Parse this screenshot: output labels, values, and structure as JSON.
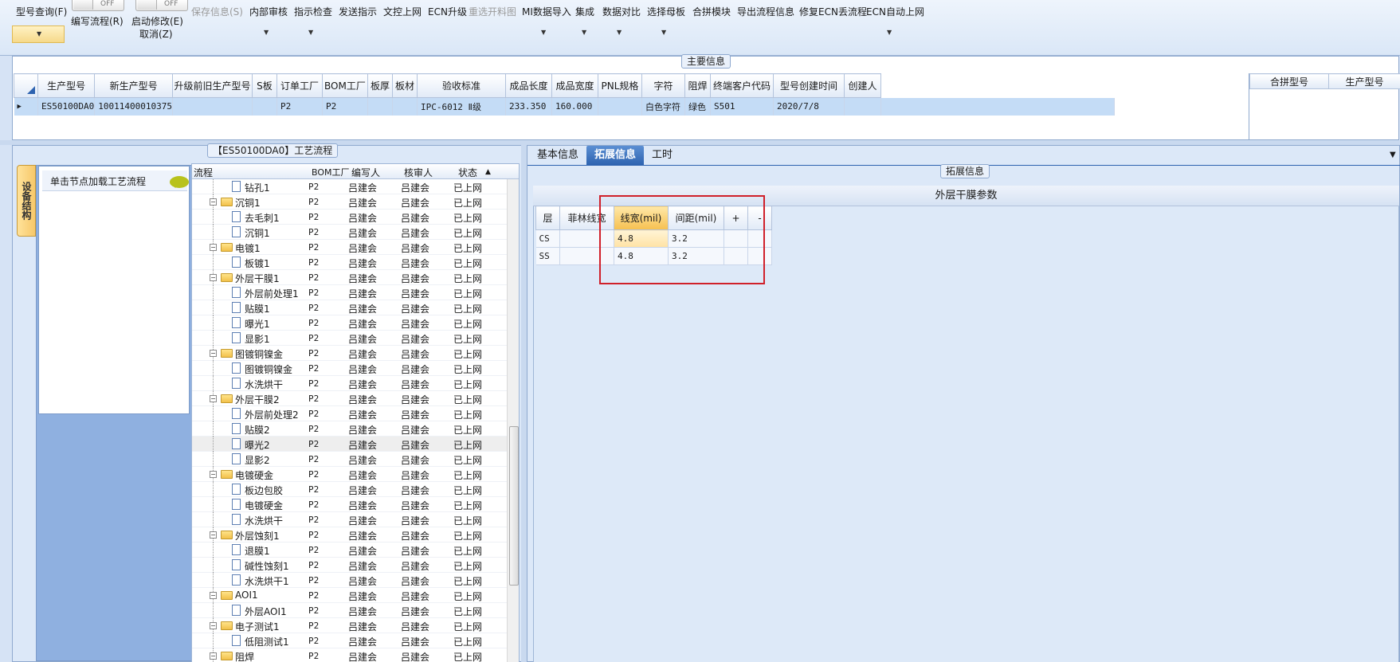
{
  "toolbar": {
    "type_query": "型号查询(F)",
    "write_flow": "编写流程(R)",
    "start_modify": "启动修改(E)",
    "cancel": "取消(Z)",
    "toggle_off_1": "OFF",
    "toggle_off_2": "OFF",
    "save_info": "保存信息(S)",
    "internal_review": "内部审核",
    "instruction_check": "指示检查",
    "send_instruction": "发送指示",
    "doc_online": "文控上网",
    "ecn_upgrade": "ECN升级",
    "reselect_material": "重选开料图",
    "mi_import": "MI数据导入",
    "integrate": "集成",
    "data_compare": "数据对比",
    "select_master": "选择母板",
    "merge_module": "合拼模块",
    "export_flow_info": "导出流程信息",
    "fix_ecn_flow": "修复ECN丢流程",
    "ecn_auto_online": "ECN自动上网"
  },
  "main_info": {
    "caption": "主要信息",
    "columns": [
      "生产型号",
      "新生产型号",
      "升级前旧生产型号",
      "S板",
      "订单工厂",
      "BOM工厂",
      "板厚",
      "板材",
      "验收标准",
      "成品长度",
      "成品宽度",
      "PNL规格",
      "字符",
      "阻焊",
      "终端客户代码",
      "型号创建时间",
      "创建人"
    ],
    "row": [
      "ES50100DA0",
      "10011400010375",
      "",
      "",
      "P2",
      "P2",
      "",
      "",
      "IPC-6012 Ⅱ级",
      "233.350",
      "160.000",
      "",
      "白色字符",
      "绿色",
      "S501",
      "2020/7/8",
      ""
    ],
    "right_columns": [
      "合拼型号",
      "生产型号"
    ]
  },
  "process_panel": {
    "caption": "【ES50100DA0】工艺流程",
    "side_tab": "设备结构",
    "click_hint": "单击节点加载工艺流程",
    "columns": [
      "流程",
      "BOM工厂",
      "编写人",
      "核审人",
      "状态"
    ],
    "rows": [
      {
        "level": 2,
        "kind": "doc",
        "name": "钻孔1",
        "bom": "P2",
        "writer": "吕建会",
        "reviewer": "吕建会",
        "status": "已上网"
      },
      {
        "level": 1,
        "kind": "folder",
        "name": "沉铜1",
        "bom": "P2",
        "writer": "吕建会",
        "reviewer": "吕建会",
        "status": "已上网"
      },
      {
        "level": 2,
        "kind": "doc",
        "name": "去毛刺1",
        "bom": "P2",
        "writer": "吕建会",
        "reviewer": "吕建会",
        "status": "已上网"
      },
      {
        "level": 2,
        "kind": "doc",
        "name": "沉铜1",
        "bom": "P2",
        "writer": "吕建会",
        "reviewer": "吕建会",
        "status": "已上网"
      },
      {
        "level": 1,
        "kind": "folder",
        "name": "电镀1",
        "bom": "P2",
        "writer": "吕建会",
        "reviewer": "吕建会",
        "status": "已上网"
      },
      {
        "level": 2,
        "kind": "doc",
        "name": "板镀1",
        "bom": "P2",
        "writer": "吕建会",
        "reviewer": "吕建会",
        "status": "已上网"
      },
      {
        "level": 1,
        "kind": "folder",
        "name": "外层干膜1",
        "bom": "P2",
        "writer": "吕建会",
        "reviewer": "吕建会",
        "status": "已上网"
      },
      {
        "level": 2,
        "kind": "doc",
        "name": "外层前处理1",
        "bom": "P2",
        "writer": "吕建会",
        "reviewer": "吕建会",
        "status": "已上网"
      },
      {
        "level": 2,
        "kind": "doc",
        "name": "贴膜1",
        "bom": "P2",
        "writer": "吕建会",
        "reviewer": "吕建会",
        "status": "已上网"
      },
      {
        "level": 2,
        "kind": "doc",
        "name": "曝光1",
        "bom": "P2",
        "writer": "吕建会",
        "reviewer": "吕建会",
        "status": "已上网"
      },
      {
        "level": 2,
        "kind": "doc",
        "name": "显影1",
        "bom": "P2",
        "writer": "吕建会",
        "reviewer": "吕建会",
        "status": "已上网"
      },
      {
        "level": 1,
        "kind": "folder",
        "name": "图镀铜镍金",
        "bom": "P2",
        "writer": "吕建会",
        "reviewer": "吕建会",
        "status": "已上网"
      },
      {
        "level": 2,
        "kind": "doc",
        "name": "图镀铜镍金",
        "bom": "P2",
        "writer": "吕建会",
        "reviewer": "吕建会",
        "status": "已上网"
      },
      {
        "level": 2,
        "kind": "doc",
        "name": "水洗烘干",
        "bom": "P2",
        "writer": "吕建会",
        "reviewer": "吕建会",
        "status": "已上网"
      },
      {
        "level": 1,
        "kind": "folder",
        "name": "外层干膜2",
        "bom": "P2",
        "writer": "吕建会",
        "reviewer": "吕建会",
        "status": "已上网"
      },
      {
        "level": 2,
        "kind": "doc",
        "name": "外层前处理2",
        "bom": "P2",
        "writer": "吕建会",
        "reviewer": "吕建会",
        "status": "已上网"
      },
      {
        "level": 2,
        "kind": "doc",
        "name": "贴膜2",
        "bom": "P2",
        "writer": "吕建会",
        "reviewer": "吕建会",
        "status": "已上网"
      },
      {
        "level": 2,
        "kind": "doc",
        "name": "曝光2",
        "bom": "P2",
        "writer": "吕建会",
        "reviewer": "吕建会",
        "status": "已上网",
        "highlight": true
      },
      {
        "level": 2,
        "kind": "doc",
        "name": "显影2",
        "bom": "P2",
        "writer": "吕建会",
        "reviewer": "吕建会",
        "status": "已上网"
      },
      {
        "level": 1,
        "kind": "folder",
        "name": "电镀硬金",
        "bom": "P2",
        "writer": "吕建会",
        "reviewer": "吕建会",
        "status": "已上网"
      },
      {
        "level": 2,
        "kind": "doc",
        "name": "板边包胶",
        "bom": "P2",
        "writer": "吕建会",
        "reviewer": "吕建会",
        "status": "已上网"
      },
      {
        "level": 2,
        "kind": "doc",
        "name": "电镀硬金",
        "bom": "P2",
        "writer": "吕建会",
        "reviewer": "吕建会",
        "status": "已上网"
      },
      {
        "level": 2,
        "kind": "doc",
        "name": "水洗烘干",
        "bom": "P2",
        "writer": "吕建会",
        "reviewer": "吕建会",
        "status": "已上网"
      },
      {
        "level": 1,
        "kind": "folder",
        "name": "外层蚀刻1",
        "bom": "P2",
        "writer": "吕建会",
        "reviewer": "吕建会",
        "status": "已上网"
      },
      {
        "level": 2,
        "kind": "doc",
        "name": "退膜1",
        "bom": "P2",
        "writer": "吕建会",
        "reviewer": "吕建会",
        "status": "已上网"
      },
      {
        "level": 2,
        "kind": "doc",
        "name": "碱性蚀刻1",
        "bom": "P2",
        "writer": "吕建会",
        "reviewer": "吕建会",
        "status": "已上网"
      },
      {
        "level": 2,
        "kind": "doc",
        "name": "水洗烘干1",
        "bom": "P2",
        "writer": "吕建会",
        "reviewer": "吕建会",
        "status": "已上网"
      },
      {
        "level": 1,
        "kind": "folder",
        "name": "AOI1",
        "bom": "P2",
        "writer": "吕建会",
        "reviewer": "吕建会",
        "status": "已上网"
      },
      {
        "level": 2,
        "kind": "doc",
        "name": "外层AOI1",
        "bom": "P2",
        "writer": "吕建会",
        "reviewer": "吕建会",
        "status": "已上网"
      },
      {
        "level": 1,
        "kind": "folder",
        "name": "电子测试1",
        "bom": "P2",
        "writer": "吕建会",
        "reviewer": "吕建会",
        "status": "已上网"
      },
      {
        "level": 2,
        "kind": "doc",
        "name": "低阻测试1",
        "bom": "P2",
        "writer": "吕建会",
        "reviewer": "吕建会",
        "status": "已上网"
      },
      {
        "level": 1,
        "kind": "folder",
        "name": "阻焊",
        "bom": "P2",
        "writer": "吕建会",
        "reviewer": "吕建会",
        "status": "已上网"
      }
    ]
  },
  "right_panel": {
    "tabs": [
      "基本信息",
      "拓展信息",
      "工时"
    ],
    "active_tab": 1,
    "ext_caption": "拓展信息",
    "param_title": "外层干膜参数",
    "param_columns": [
      "层",
      "菲林线宽",
      "线宽(mil)",
      "间距(mil)",
      "+",
      "-"
    ],
    "param_rows": [
      [
        "CS",
        "",
        "4.8",
        "3.2",
        "",
        ""
      ],
      [
        "SS",
        "",
        "4.8",
        "3.2",
        "",
        ""
      ]
    ]
  }
}
